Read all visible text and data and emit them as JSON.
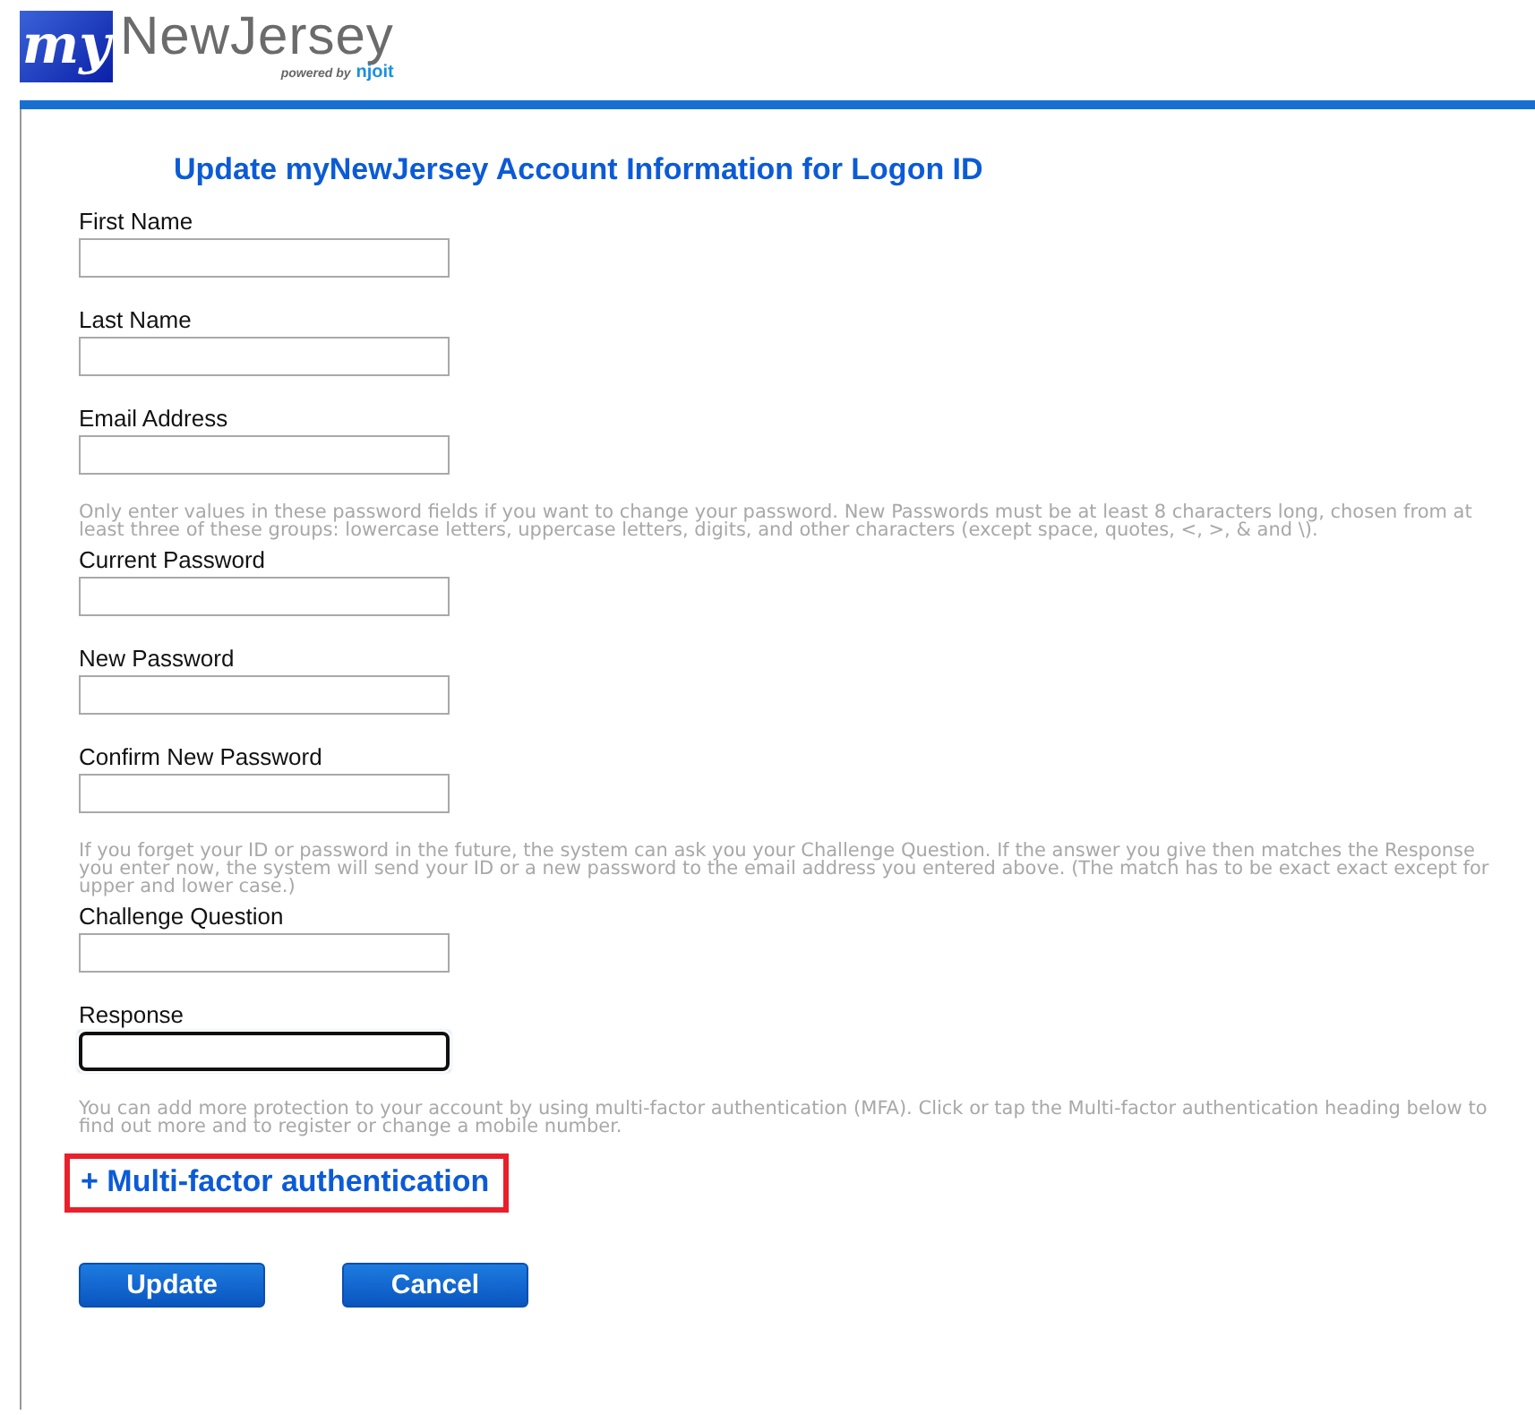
{
  "logo": {
    "mark": "my",
    "name": "NewJersey",
    "powered_by": "powered by",
    "vendor": "njoit"
  },
  "title": "Update myNewJersey Account Information for Logon ID",
  "sections": [
    {
      "fields": [
        {
          "label": "First Name",
          "focused": false
        },
        {
          "label": "Last Name",
          "focused": false
        },
        {
          "label": "Email Address",
          "focused": false
        }
      ]
    },
    {
      "note": "Only enter values in these password fields if you want to change your password. New Passwords must be at least 8 characters long, chosen from at least three of these groups: lowercase letters, uppercase letters, digits, and other characters (except space, quotes, <, >, & and \\).",
      "fields": [
        {
          "label": "Current Password",
          "focused": false
        },
        {
          "label": "New Password",
          "focused": false
        },
        {
          "label": "Confirm New Password",
          "focused": false
        }
      ]
    },
    {
      "note": "If you forget your ID or password in the future, the system can ask you your Challenge Question. If the answer you give then matches the Response you enter now, the system will send your ID or a new password to the email address you entered above. (The match has to be exact exact except for upper and lower case.)",
      "fields": [
        {
          "label": "Challenge Question",
          "focused": false
        },
        {
          "label": "Response",
          "focused": true
        }
      ]
    }
  ],
  "mfa_note": "You can add more protection to your account by using multi-factor authentication (MFA). Click or tap the Multi-factor authentication heading below to find out more and to register or change a mobile number.",
  "mfa_link": {
    "symbol": "+",
    "label": "Multi-factor authentication",
    "highlighted": true
  },
  "buttons": [
    "Update",
    "Cancel"
  ]
}
